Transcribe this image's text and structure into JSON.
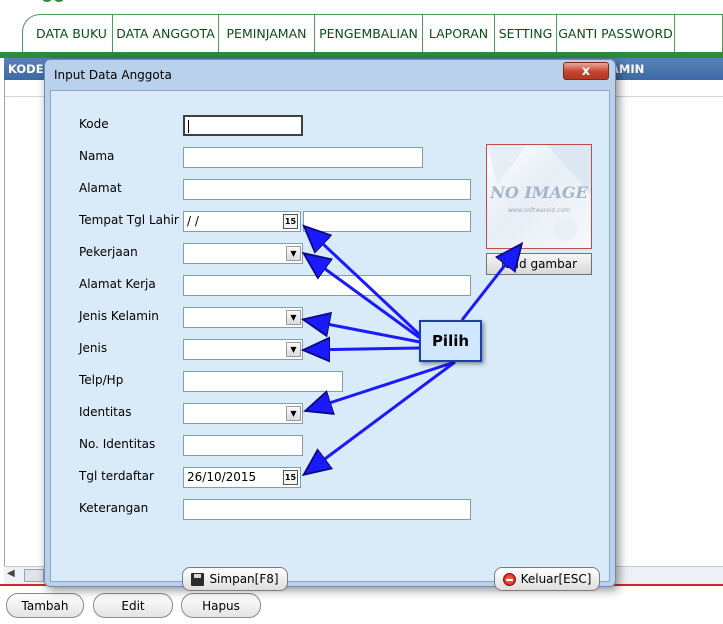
{
  "nav": {
    "items": [
      {
        "label": "DATA BUKU"
      },
      {
        "label": "DATA ANGGOTA"
      },
      {
        "label": "PEMINJAMAN"
      },
      {
        "label": "PENGEMBALIAN"
      },
      {
        "label": "LAPORAN"
      },
      {
        "label": "SETTING"
      },
      {
        "label": "GANTI PASSWORD"
      }
    ]
  },
  "table": {
    "col_kode": "KODE",
    "col_kelamin_partial": "AMIN"
  },
  "bottom_buttons": {
    "tambah": "Tambah",
    "edit": "Edit",
    "hapus": "Hapus"
  },
  "dialog": {
    "title": "Input Data Anggota",
    "close_label": "x",
    "labels": {
      "kode": "Kode",
      "nama": "Nama",
      "alamat": "Alamat",
      "tempat_tgl_lahir": "Tempat Tgl Lahir",
      "pekerjaan": "Pekerjaan",
      "alamat_kerja": "Alamat Kerja",
      "jenis_kelamin": "Jenis Kelamin",
      "jenis": "Jenis",
      "telp": "Telp/Hp",
      "identitas": "Identitas",
      "no_identitas": "No. Identitas",
      "tgl_terdaftar": "Tgl terdaftar",
      "keterangan": "Keterangan"
    },
    "values": {
      "tgl_lahir": " /  /",
      "tgl_terdaftar": "26/10/2015"
    },
    "calendar_glyph": "15",
    "photo": {
      "no_image_text": "NO IMAGE",
      "watermark": "www.softwareid.com"
    },
    "load_button": "load gambar",
    "simpan_button": "Simpan[F8]",
    "keluar_button": "Keluar[ESC]"
  },
  "annotation": {
    "callout_text": "Pilih",
    "arrow_color": "#1a1aff"
  },
  "colors": {
    "nav_border": "#4f9b5b",
    "nav_text": "#0d4d17",
    "green_band": "#2e8b3a",
    "table_header": "#4a76ad",
    "dialog_bg": "#b9d1ea",
    "client_bg": "#d9eaf9",
    "close_button": "#c7432e",
    "red_line": "#d62828"
  }
}
